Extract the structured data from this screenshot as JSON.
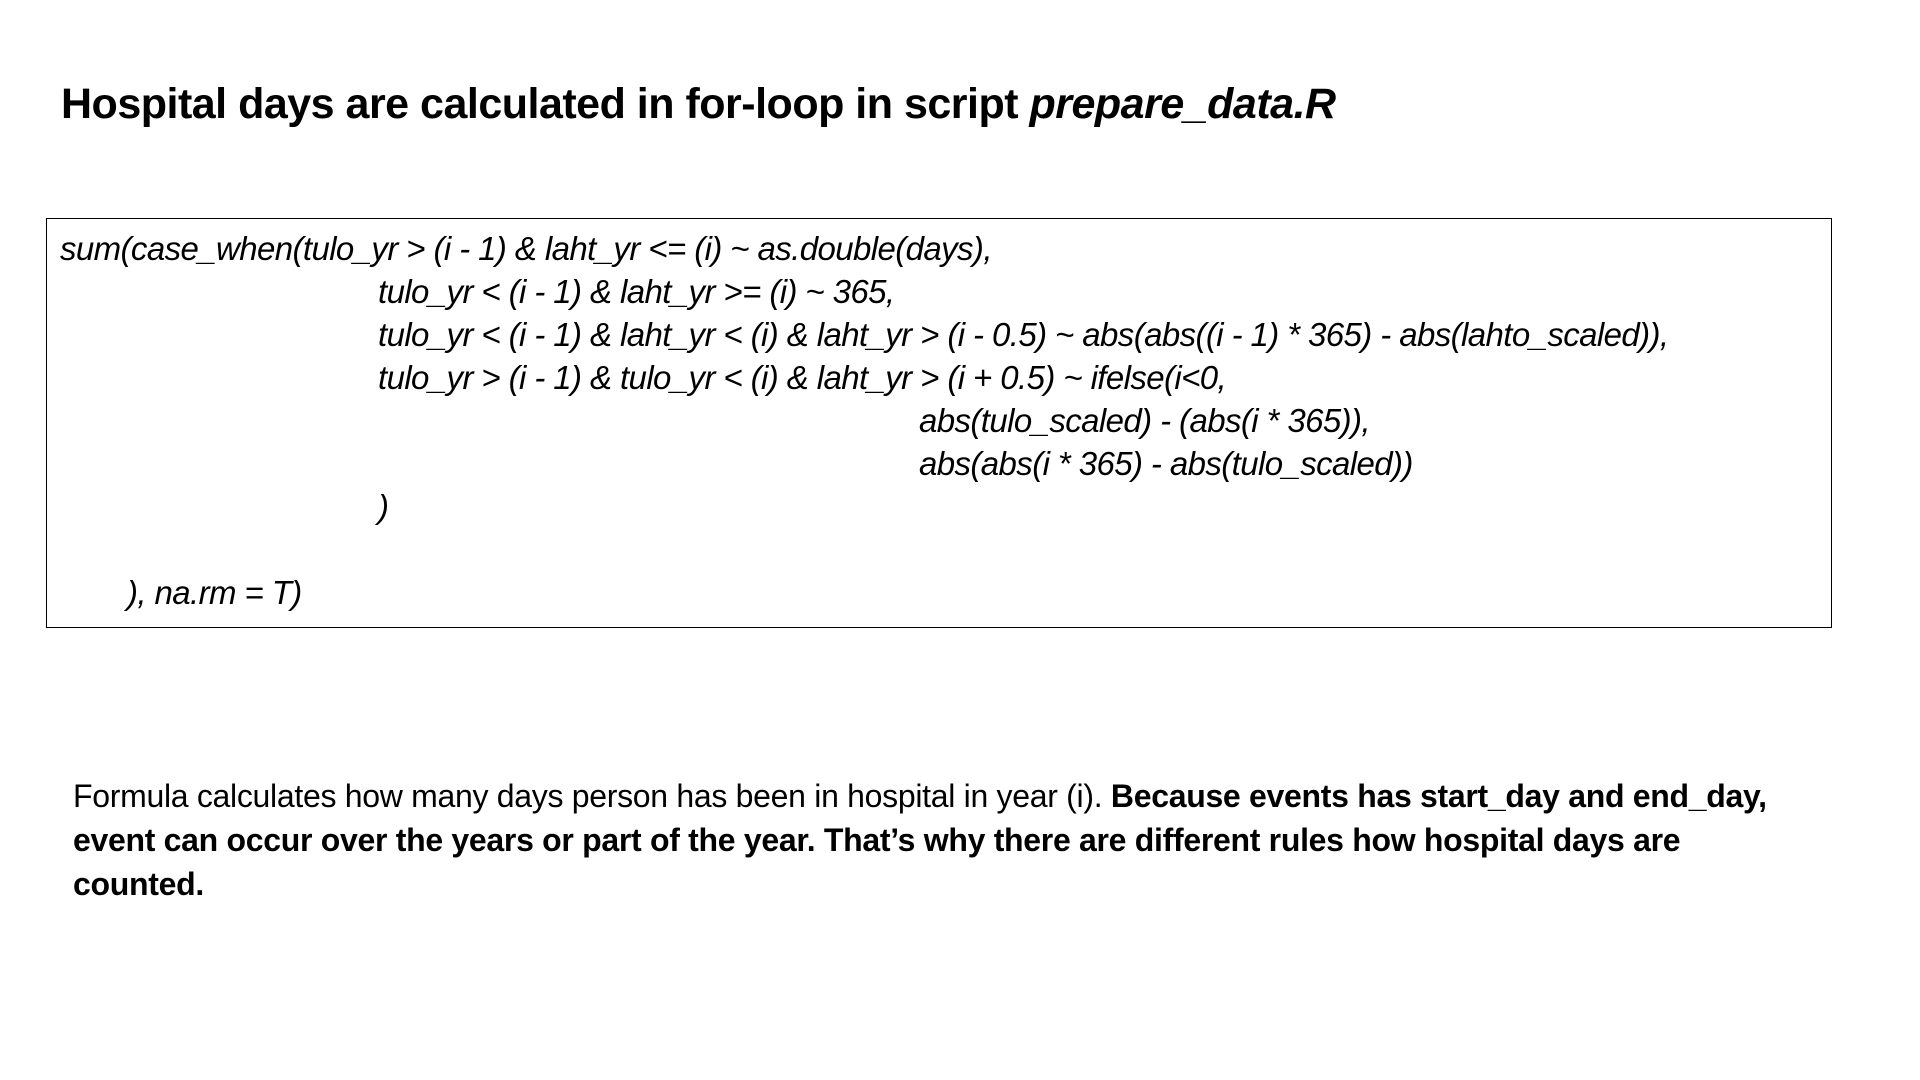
{
  "slide": {
    "title_prefix": "Hospital days are calculated in for-loop in script ",
    "title_script": "prepare_data.R"
  },
  "code": {
    "lines": [
      "sum(case_when(tulo_yr > (i - 1) & laht_yr <= (i) ~ as.double(days),",
      "tulo_yr < (i - 1) & laht_yr >= (i) ~ 365,",
      "tulo_yr < (i - 1) & laht_yr < (i) & laht_yr > (i - 0.5) ~ abs(abs((i - 1) * 365) - abs(lahto_scaled)),",
      "tulo_yr > (i - 1) & tulo_yr < (i) & laht_yr > (i + 0.5) ~ ifelse(i<0,",
      "abs(tulo_scaled) - (abs(i * 365)),",
      "abs(abs(i * 365) - abs(tulo_scaled))",
      ")",
      "), na.rm = T)"
    ]
  },
  "description": {
    "normal": "Formula calculates how many days person has been in hospital in year (i). ",
    "bold": "Because events has start_day and end_day, event can occur over the years or part of the year. That’s why there are different rules how hospital days are counted."
  }
}
